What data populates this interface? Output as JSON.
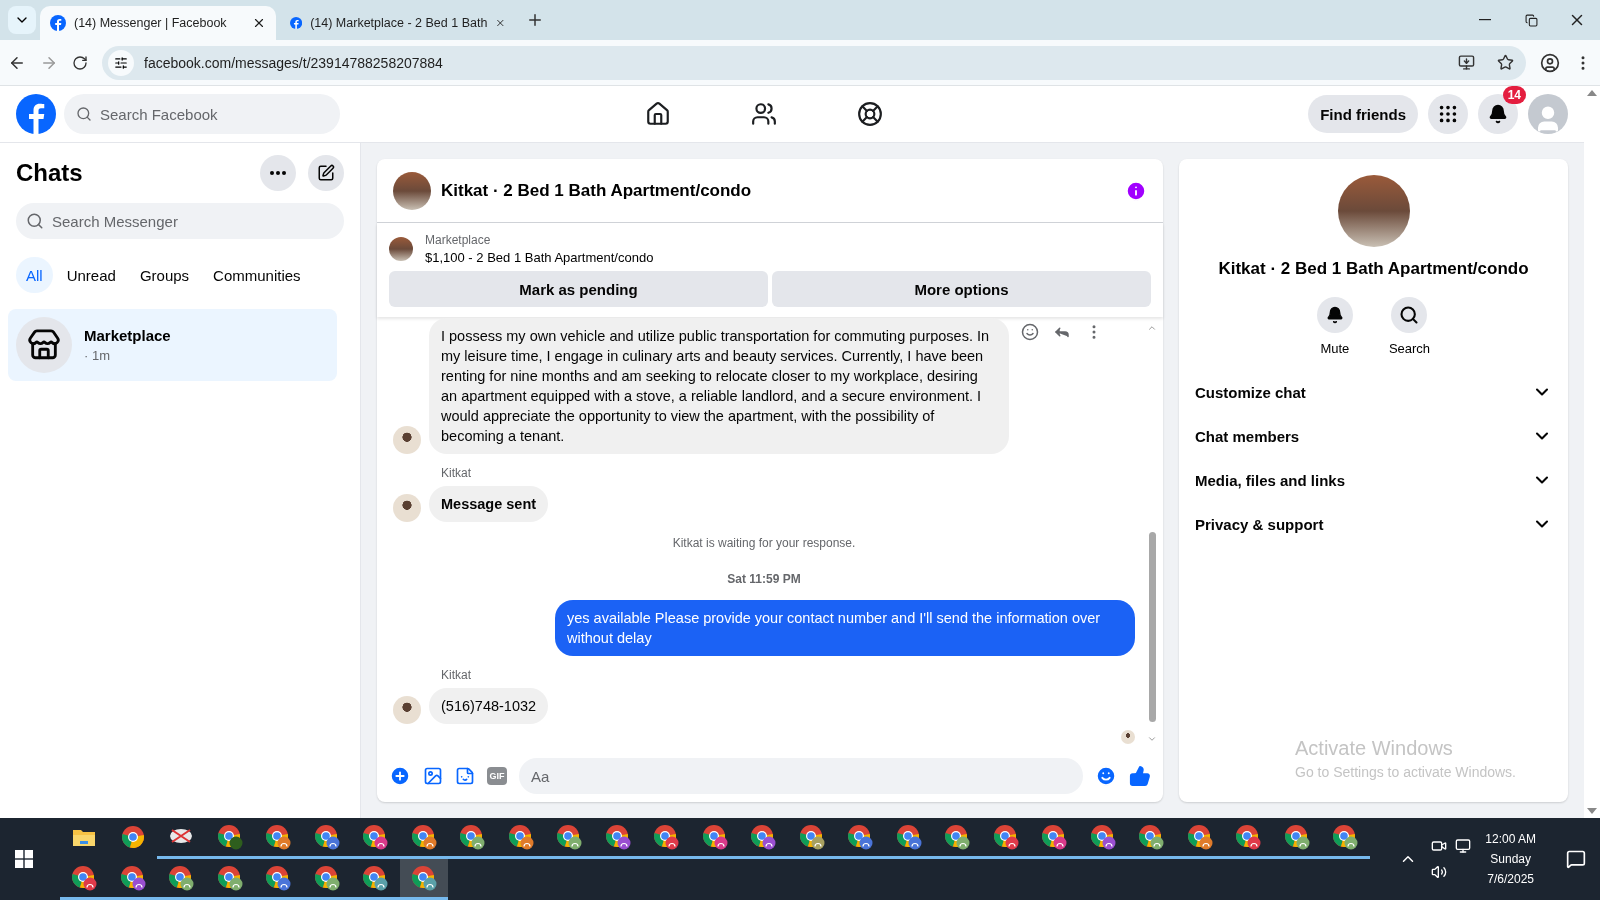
{
  "browser": {
    "tabs": [
      {
        "title": "(14) Messenger | Facebook",
        "selected": true
      },
      {
        "title": "(14) Marketplace - 2 Bed 1 Bath",
        "selected": false
      }
    ],
    "url": "facebook.com/messages/t/23914788258207884"
  },
  "header": {
    "search_placeholder": "Search Facebook",
    "nav": [
      {
        "kind": "home",
        "selected": false
      },
      {
        "kind": "friends",
        "selected": false
      },
      {
        "kind": "groups",
        "selected": false
      }
    ],
    "find_friends": "Find friends",
    "notification_count": "14"
  },
  "chats": {
    "title": "Chats",
    "search_placeholder": "Search Messenger",
    "filters": [
      {
        "label": "All",
        "selected": true
      },
      {
        "label": "Unread",
        "selected": false
      },
      {
        "label": "Groups",
        "selected": false
      },
      {
        "label": "Communities",
        "selected": false
      }
    ],
    "conversations": [
      {
        "name": "Marketplace",
        "time": "· 1m",
        "selected": true
      }
    ]
  },
  "conversation": {
    "title": "Kitkat · 2 Bed 1 Bath Apartment/condo",
    "listing": {
      "source": "Marketplace",
      "title": "$1,100 - 2 Bed 1 Bath Apartment/condo"
    },
    "actions": [
      "Mark as pending",
      "More options"
    ],
    "messages": [
      {
        "kind": "incoming",
        "text": "I possess my own vehicle and utilize public transportation for commuting purposes. In my leisure time, I engage in culinary arts and beauty services. Currently, I have been renting for nine months and am seeking to relocate closer to my workplace, desiring an apartment equipped with a stove, a reliable landlord, and a secure environment. I would appreciate the opportunity to view the apartment, with the possibility of becoming a tenant."
      },
      {
        "kind": "incoming",
        "sender": "Kitkat",
        "text": "Message sent",
        "bold": true
      },
      {
        "kind": "status",
        "text": "Kitkat is waiting for your response."
      },
      {
        "kind": "timestamp",
        "text": "Sat 11:59 PM"
      },
      {
        "kind": "outgoing",
        "text": "yes available Please provide your contact number and I'll send the information over without delay"
      },
      {
        "kind": "incoming",
        "sender": "Kitkat",
        "text": "(516)748-1032"
      }
    ],
    "composer": {
      "gif_label": "GIF",
      "placeholder": "Aa"
    }
  },
  "details": {
    "title": "Kitkat · 2 Bed 1 Bath Apartment/condo",
    "actions": [
      {
        "kind": "bell",
        "label": "Mute"
      },
      {
        "kind": "search",
        "label": "Search"
      }
    ],
    "sections": [
      "Customize chat",
      "Chat members",
      "Media, files and links",
      "Privacy & support"
    ]
  },
  "os_notice": {
    "title": "Activate Windows",
    "subtitle": "Go to Settings to activate Windows."
  },
  "taskbar": {
    "rows": [
      [
        {
          "kind": "folder",
          "running": false,
          "selected": false
        },
        {
          "kind": "chrome",
          "running": false,
          "selected": false
        },
        {
          "kind": "snip",
          "running": true,
          "selected": false
        },
        {
          "kind": "letter",
          "color": "#2e5e1e",
          "running": true,
          "selected": false
        },
        {
          "kind": "profile",
          "color": "#e07b2a",
          "running": true,
          "selected": false
        },
        {
          "kind": "profile",
          "color": "#4a74d8",
          "running": true,
          "selected": false
        },
        {
          "kind": "profile",
          "color": "#d93a8a",
          "running": true,
          "selected": false
        },
        {
          "kind": "profile",
          "color": "#e07b2a",
          "running": true,
          "selected": false
        },
        {
          "kind": "profile",
          "color": "#7fae6e",
          "running": true,
          "selected": false
        },
        {
          "kind": "profile",
          "color": "#e07b2a",
          "running": true,
          "selected": false
        },
        {
          "kind": "profile",
          "color": "#7fae6e",
          "running": true,
          "selected": false
        },
        {
          "kind": "profile",
          "color": "#9a4fd0",
          "running": true,
          "selected": false
        },
        {
          "kind": "profile",
          "color": "#e03a4a",
          "running": true,
          "selected": false
        },
        {
          "kind": "profile",
          "color": "#d93a8a",
          "running": true,
          "selected": false
        },
        {
          "kind": "profile",
          "color": "#9a4fd0",
          "running": true,
          "selected": false
        },
        {
          "kind": "profile",
          "color": "#a7a060",
          "running": true,
          "selected": false
        },
        {
          "kind": "profile",
          "color": "#4a74d8",
          "running": true,
          "selected": false
        },
        {
          "kind": "profile",
          "color": "#4a74d8",
          "running": true,
          "selected": false
        },
        {
          "kind": "profile",
          "color": "#7fae6e",
          "running": true,
          "selected": false
        },
        {
          "kind": "profile",
          "color": "#e03a4a",
          "running": true,
          "selected": false
        },
        {
          "kind": "profile",
          "color": "#d93a8a",
          "running": true,
          "selected": false
        },
        {
          "kind": "profile",
          "color": "#9a4fd0",
          "running": true,
          "selected": false
        },
        {
          "kind": "profile",
          "color": "#7fae6e",
          "running": true,
          "selected": false
        },
        {
          "kind": "profile",
          "color": "#e07b2a",
          "running": true,
          "selected": false
        },
        {
          "kind": "profile",
          "color": "#e03a4a",
          "running": true,
          "selected": false
        },
        {
          "kind": "profile",
          "color": "#7fae6e",
          "running": true,
          "selected": false
        },
        {
          "kind": "profile",
          "color": "#7fae6e",
          "running": true,
          "selected": false
        }
      ],
      [
        {
          "kind": "profile",
          "color": "#e03a4a",
          "running": true,
          "selected": false
        },
        {
          "kind": "profile",
          "color": "#9a4fd0",
          "running": true,
          "selected": false
        },
        {
          "kind": "profile",
          "color": "#7fae6e",
          "running": true,
          "selected": false
        },
        {
          "kind": "profile",
          "color": "#7fae6e",
          "running": true,
          "selected": false
        },
        {
          "kind": "profile",
          "color": "#4a74d8",
          "running": true,
          "selected": false
        },
        {
          "kind": "profile",
          "color": "#7fae6e",
          "running": true,
          "selected": false
        },
        {
          "kind": "profile",
          "color": "#5aa0a8",
          "running": true,
          "selected": false
        },
        {
          "kind": "profile",
          "color": "#5aa0a8",
          "running": true,
          "selected": true
        }
      ]
    ],
    "clock": {
      "time": "12:00 AM",
      "day": "Sunday",
      "date": "7/6/2025"
    }
  }
}
